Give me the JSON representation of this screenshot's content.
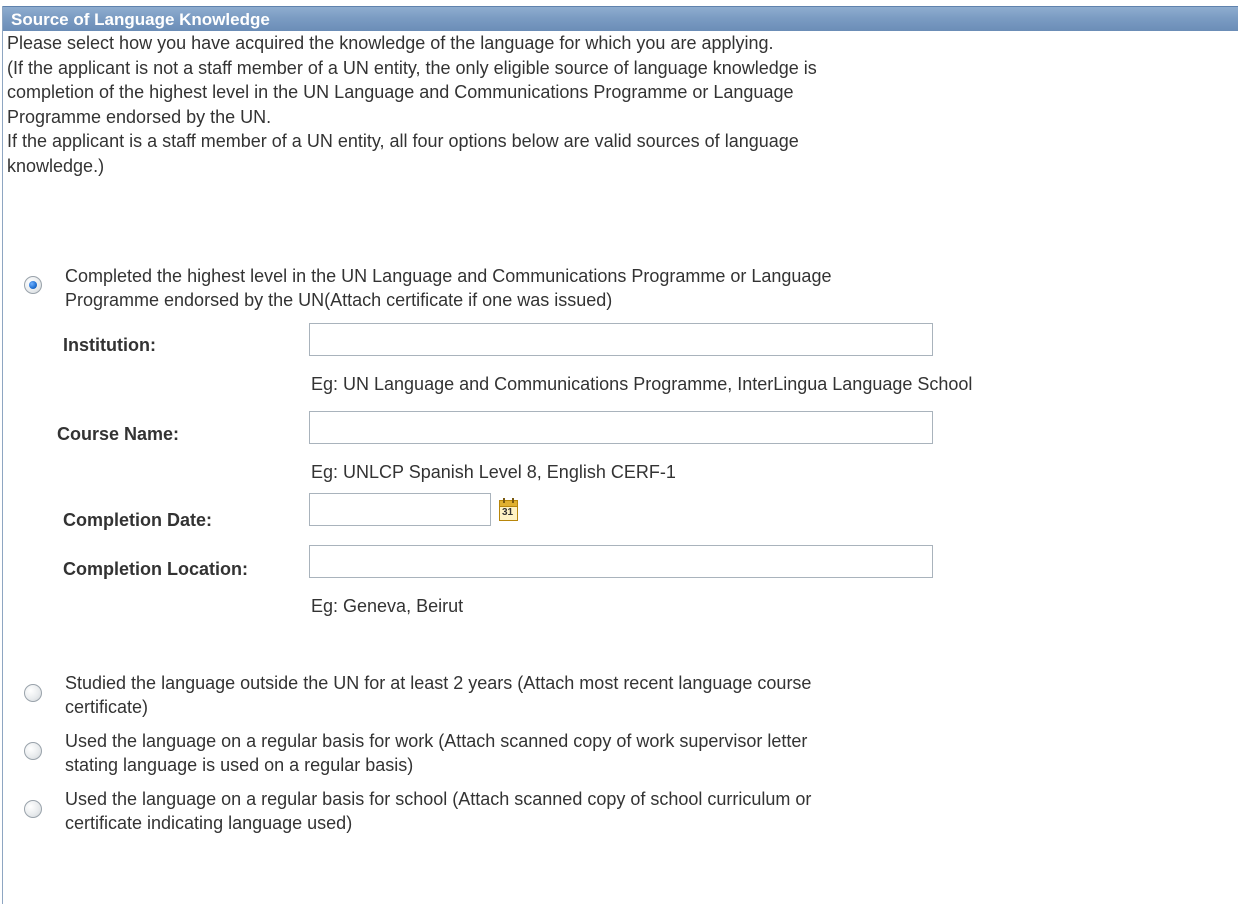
{
  "section": {
    "title": "Source of Language Knowledge"
  },
  "intro": {
    "lines": [
      "Please select how you have acquired the knowledge of the language for which you are applying.",
      "(If the applicant is not a staff member of a UN entity, the only eligible source of language knowledge is",
      "completion of the highest level in the UN Language and Communications Programme or Language",
      "Programme endorsed by the UN.",
      "If the applicant is a staff member of a UN entity, all four options below are valid sources of language",
      "knowledge.)"
    ]
  },
  "options": [
    {
      "selected": true,
      "lines": [
        "Completed the highest level in the UN Language and Communications Programme or Language",
        "Programme endorsed by the UN(Attach certificate if one was issued)"
      ]
    },
    {
      "selected": false,
      "lines": [
        "Studied the language outside the UN for at least 2 years (Attach most recent language course",
        "certificate)"
      ]
    },
    {
      "selected": false,
      "lines": [
        "Used the language on a regular basis for work (Attach scanned copy of work supervisor letter",
        "stating language is used on a regular basis)"
      ]
    },
    {
      "selected": false,
      "lines": [
        "Used the language on a regular basis for school (Attach scanned copy of school curriculum or",
        "certificate indicating language used)"
      ]
    }
  ],
  "fields": {
    "institution": {
      "label": "Institution:",
      "value": "",
      "hint": "Eg: UN Language and Communications Programme, InterLingua Language School"
    },
    "course_name": {
      "label": "Course Name:",
      "value": "",
      "hint": "Eg: UNLCP Spanish Level 8, English CERF-1"
    },
    "completion_date": {
      "label": "Completion Date:",
      "value": "",
      "calendar_icon": "calendar-icon",
      "calendar_text": "31"
    },
    "completion_location": {
      "label": "Completion Location:",
      "value": "",
      "hint": "Eg: Geneva, Beirut"
    }
  },
  "colors": {
    "header_bg": "#7b9cc3",
    "header_text": "#ffffff",
    "text": "#333333",
    "radio_selected": "#1f6fd1"
  }
}
